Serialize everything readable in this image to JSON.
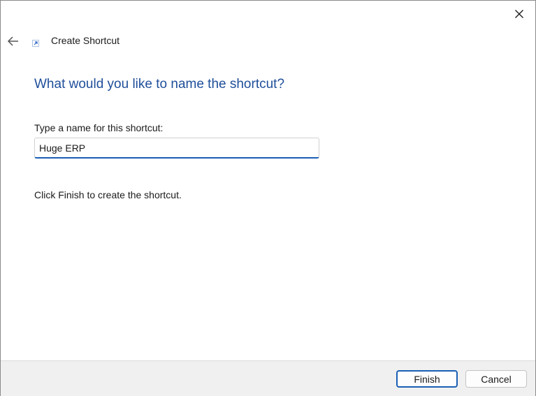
{
  "window": {
    "title": "Create Shortcut",
    "close_icon": "close-icon",
    "back_icon": "back-arrow-icon",
    "wizard_icon": "shortcut-arrow-icon"
  },
  "main": {
    "instruction": "What would you like to name the shortcut?",
    "field_label": "Type a name for this shortcut:",
    "name_value": "Huge ERP",
    "info": "Click Finish to create the shortcut."
  },
  "footer": {
    "finish_label": "Finish",
    "cancel_label": "Cancel"
  },
  "colors": {
    "instruction_text": "#1f4e9a",
    "accent": "#1a5fb4",
    "footer_bg": "#f0f0f0"
  }
}
